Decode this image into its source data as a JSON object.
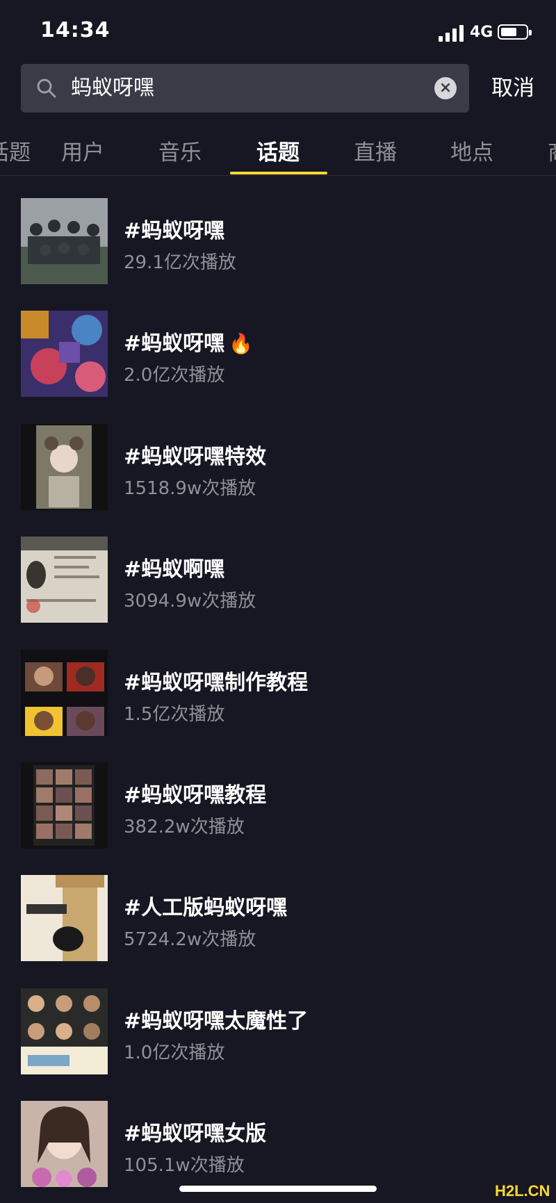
{
  "status_bar": {
    "time": "14:34",
    "network": "4G",
    "signal_bars": 4,
    "battery_level": 0.55
  },
  "search": {
    "query": "蚂蚁呀嘿",
    "cancel_label": "取消",
    "icon": "search-icon",
    "clear_icon": "clear-icon"
  },
  "tabs": [
    {
      "label": "话题"
    },
    {
      "label": "用户"
    },
    {
      "label": "音乐"
    },
    {
      "label": "话题",
      "active": true
    },
    {
      "label": "直播"
    },
    {
      "label": "地点"
    },
    {
      "label": "商"
    }
  ],
  "accent_color": "#fdd830",
  "background_color": "#161722",
  "results": [
    {
      "title": "#蚂蚁呀嘿",
      "plays": "29.1亿次播放",
      "hot": false
    },
    {
      "title": "#蚂蚁呀嘿",
      "plays": "2.0亿次播放",
      "hot": true
    },
    {
      "title": "#蚂蚁呀嘿特效",
      "plays": "1518.9w次播放",
      "hot": false
    },
    {
      "title": "#蚂蚁啊嘿",
      "plays": "3094.9w次播放",
      "hot": false
    },
    {
      "title": "#蚂蚁呀嘿制作教程",
      "plays": "1.5亿次播放",
      "hot": false
    },
    {
      "title": "#蚂蚁呀嘿教程",
      "plays": "382.2w次播放",
      "hot": false
    },
    {
      "title": "#人工版蚂蚁呀嘿",
      "plays": "5724.2w次播放",
      "hot": false
    },
    {
      "title": "#蚂蚁呀嘿太魔性了",
      "plays": "1.0亿次播放",
      "hot": false
    },
    {
      "title": "#蚂蚁呀嘿女版",
      "plays": "105.1w次播放",
      "hot": false
    }
  ],
  "watermark": "H2L.CN"
}
